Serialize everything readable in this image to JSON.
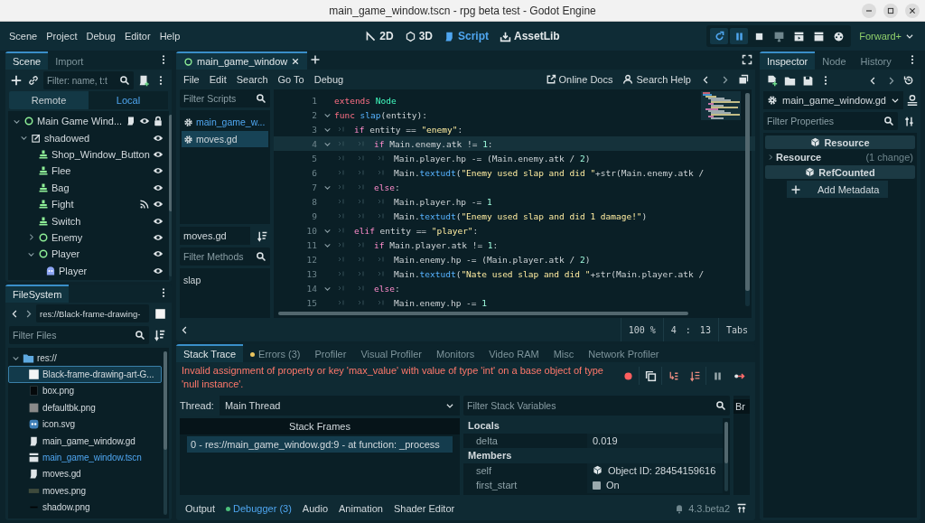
{
  "window": {
    "title": "main_game_window.tscn - rpg beta test - Godot Engine"
  },
  "menu": [
    "Scene",
    "Project",
    "Debug",
    "Editor",
    "Help"
  ],
  "workspaces": [
    {
      "label": "2D",
      "kind": "planar",
      "selected": false
    },
    {
      "label": "3D",
      "kind": "spatial",
      "selected": false
    },
    {
      "label": "Script",
      "kind": "script",
      "selected": true
    },
    {
      "label": "AssetLib",
      "kind": "assetlib",
      "selected": false
    }
  ],
  "run_controls": [
    {
      "kind": "restart",
      "on": true
    },
    {
      "kind": "pause",
      "on": true
    },
    {
      "kind": "stop",
      "on": false
    },
    {
      "kind": "remote",
      "on": false
    },
    {
      "kind": "play-scene",
      "on": false
    },
    {
      "kind": "play-custom",
      "on": false
    },
    {
      "kind": "movie",
      "on": false
    }
  ],
  "renderer": "Forward+",
  "scene_dock": {
    "tabs": [
      {
        "label": "Scene",
        "selected": true
      },
      {
        "label": "Import",
        "selected": false
      }
    ],
    "filter": {
      "placeholder": "Filter: name, t:t"
    },
    "modes": [
      {
        "label": "Remote",
        "selected": false
      },
      {
        "label": "Local",
        "selected": true
      }
    ],
    "tree": [
      {
        "label": "Main Game Wind...",
        "kind": "node",
        "expanded": true,
        "signals": false,
        "script": true,
        "visible": true,
        "locked": true,
        "children": [
          {
            "label": "shadowed",
            "kind": "layer",
            "expanded": true,
            "signals": false,
            "script": false,
            "visible": true,
            "locked": false,
            "children": [
              {
                "label": "Shop_Window_Button",
                "kind": "button",
                "signals": false,
                "script": false,
                "visible": true,
                "locked": false
              },
              {
                "label": "Flee",
                "kind": "button",
                "signals": false,
                "script": false,
                "visible": true,
                "locked": false
              },
              {
                "label": "Bag",
                "kind": "button",
                "signals": false,
                "script": false,
                "visible": true,
                "locked": false
              },
              {
                "label": "Fight",
                "kind": "button",
                "signals": true,
                "script": false,
                "visible": true,
                "locked": false
              },
              {
                "label": "Switch",
                "kind": "button",
                "signals": false,
                "script": false,
                "visible": true,
                "locked": false
              },
              {
                "label": "Enemy",
                "kind": "node",
                "expanded": false,
                "signals": false,
                "script": false,
                "visible": true,
                "locked": false
              },
              {
                "label": "Player",
                "kind": "node",
                "expanded": true,
                "signals": false,
                "script": false,
                "visible": true,
                "locked": false,
                "children": [
                  {
                    "label": "Player",
                    "kind": "sprite",
                    "signals": false,
                    "script": false,
                    "visible": true,
                    "locked": false
                  }
                ]
              }
            ]
          }
        ]
      }
    ]
  },
  "filesystem": {
    "tabs": [
      {
        "label": "FileSystem",
        "selected": true
      }
    ],
    "path": "res://Black-frame-drawing-",
    "filter": {
      "placeholder": "Filter Files"
    },
    "tree": [
      {
        "label": "res://",
        "kind": "folder",
        "expanded": true,
        "selected": false,
        "current": false,
        "children": [
          {
            "label": "Black-frame-drawing-art-G...",
            "kind": "white-image",
            "selected": true,
            "current": false
          },
          {
            "label": "box.png",
            "kind": "dark-image",
            "selected": false,
            "current": false
          },
          {
            "label": "defaultbk.png",
            "kind": "grey-image",
            "selected": false,
            "current": false
          },
          {
            "label": "icon.svg",
            "kind": "logo-image",
            "selected": false,
            "current": false
          },
          {
            "label": "main_game_window.gd",
            "kind": "script",
            "selected": false,
            "current": false
          },
          {
            "label": "main_game_window.tscn",
            "kind": "scene",
            "selected": false,
            "current": true
          },
          {
            "label": "moves.gd",
            "kind": "script",
            "selected": false,
            "current": false
          },
          {
            "label": "moves.png",
            "kind": "strip-image",
            "selected": false,
            "current": false
          },
          {
            "label": "shadow.png",
            "kind": "line-image",
            "selected": false,
            "current": false
          }
        ]
      }
    ]
  },
  "script_editor": {
    "tabs": [
      {
        "label": "main_game_window",
        "selected": true
      }
    ],
    "menu": [
      "File",
      "Edit",
      "Search",
      "Go To",
      "Debug"
    ],
    "help_links": [
      {
        "label": "Online Docs",
        "kind": "docs"
      },
      {
        "label": "Search Help",
        "kind": "help"
      }
    ],
    "script_filter": {
      "placeholder": "Filter Scripts"
    },
    "scripts": [
      {
        "label": "main_game_w...",
        "selected": false,
        "current": true
      },
      {
        "label": "moves.gd",
        "selected": true,
        "current": false
      }
    ],
    "current_script": "moves.gd",
    "method_filter": {
      "placeholder": "Filter Methods"
    },
    "methods": [
      "slap"
    ],
    "code": [
      {
        "number": "1",
        "selected": false,
        "tokens": [
          {
            "kind": "keyword",
            "text": "extends"
          },
          {
            "kind": "type",
            "text": " Node"
          }
        ]
      },
      {
        "number": "2",
        "selected": false,
        "tokens": [
          {
            "kind": "keyword",
            "text": "func"
          },
          {
            "kind": "function",
            "text": " slap"
          },
          {
            "kind": "plain",
            "text": "(entity):"
          }
        ],
        "children": [
          {
            "number": "3",
            "selected": false,
            "tokens": [
              {
                "kind": "control",
                "text": "if"
              },
              {
                "kind": "plain",
                "text": " entity == "
              },
              {
                "kind": "string",
                "text": "\"enemy\""
              },
              {
                "kind": "plain",
                "text": ":"
              }
            ],
            "children": [
              {
                "number": "4",
                "selected": true,
                "tokens": [
                  {
                    "kind": "control",
                    "text": "if"
                  },
                  {
                    "kind": "plain",
                    "text": " Main.enemy.atk != "
                  },
                  {
                    "kind": "number",
                    "text": "1"
                  },
                  {
                    "kind": "plain",
                    "text": ":"
                  }
                ],
                "children": [
                  {
                    "number": "5",
                    "selected": false,
                    "tokens": [
                      {
                        "kind": "plain",
                        "text": "Main.player.hp -= (Main.enemy.atk / "
                      },
                      {
                        "kind": "number",
                        "text": "2"
                      },
                      {
                        "kind": "plain",
                        "text": ")"
                      }
                    ]
                  },
                  {
                    "number": "6",
                    "selected": false,
                    "tokens": [
                      {
                        "kind": "plain",
                        "text": "Main."
                      },
                      {
                        "kind": "function",
                        "text": "textudt"
                      },
                      {
                        "kind": "plain",
                        "text": "("
                      },
                      {
                        "kind": "string",
                        "text": "\"Enemy used slap and did \""
                      },
                      {
                        "kind": "plain",
                        "text": "+str(Main.enemy.atk /"
                      }
                    ]
                  }
                ]
              },
              {
                "number": "7",
                "selected": false,
                "tokens": [
                  {
                    "kind": "control",
                    "text": "else"
                  },
                  {
                    "kind": "plain",
                    "text": ":"
                  }
                ],
                "children": [
                  {
                    "number": "8",
                    "selected": false,
                    "tokens": [
                      {
                        "kind": "plain",
                        "text": "Main.player.hp -= "
                      },
                      {
                        "kind": "number",
                        "text": "1"
                      }
                    ]
                  },
                  {
                    "number": "9",
                    "selected": false,
                    "tokens": [
                      {
                        "kind": "plain",
                        "text": "Main."
                      },
                      {
                        "kind": "function",
                        "text": "textudt"
                      },
                      {
                        "kind": "plain",
                        "text": "("
                      },
                      {
                        "kind": "string",
                        "text": "\"Enemy used slap and did 1 damage!\""
                      },
                      {
                        "kind": "plain",
                        "text": ")"
                      }
                    ]
                  }
                ]
              }
            ]
          },
          {
            "number": "10",
            "selected": false,
            "tokens": [
              {
                "kind": "control",
                "text": "elif"
              },
              {
                "kind": "plain",
                "text": " entity == "
              },
              {
                "kind": "string",
                "text": "\"player\""
              },
              {
                "kind": "plain",
                "text": ":"
              }
            ],
            "children": [
              {
                "number": "11",
                "selected": false,
                "tokens": [
                  {
                    "kind": "control",
                    "text": "if"
                  },
                  {
                    "kind": "plain",
                    "text": " Main.player.atk != "
                  },
                  {
                    "kind": "number",
                    "text": "1"
                  },
                  {
                    "kind": "plain",
                    "text": ":"
                  }
                ],
                "children": [
                  {
                    "number": "12",
                    "selected": false,
                    "tokens": [
                      {
                        "kind": "plain",
                        "text": "Main.enemy.hp -= (Main.player.atk / "
                      },
                      {
                        "kind": "number",
                        "text": "2"
                      },
                      {
                        "kind": "plain",
                        "text": ")"
                      }
                    ]
                  },
                  {
                    "number": "13",
                    "selected": false,
                    "tokens": [
                      {
                        "kind": "plain",
                        "text": "Main."
                      },
                      {
                        "kind": "function",
                        "text": "textudt"
                      },
                      {
                        "kind": "plain",
                        "text": "("
                      },
                      {
                        "kind": "string",
                        "text": "\"Nate used slap and did \""
                      },
                      {
                        "kind": "plain",
                        "text": "+str(Main.player.atk /"
                      }
                    ]
                  }
                ]
              },
              {
                "number": "14",
                "selected": false,
                "tokens": [
                  {
                    "kind": "control",
                    "text": "else"
                  },
                  {
                    "kind": "plain",
                    "text": ":"
                  }
                ],
                "children": [
                  {
                    "number": "15",
                    "selected": false,
                    "tokens": [
                      {
                        "kind": "plain",
                        "text": "Main.enemy.hp -= "
                      },
                      {
                        "kind": "number",
                        "text": "1"
                      }
                    ]
                  }
                ]
              }
            ]
          }
        ]
      }
    ],
    "zoom": "100 %",
    "position": {
      "line": "4",
      "separator": ":",
      "column": "13"
    },
    "indent_mode": "Tabs"
  },
  "debugger": {
    "tabs": [
      {
        "label": "Stack Trace",
        "selected": true,
        "alert": false
      },
      {
        "label": "Errors (3)",
        "selected": false,
        "alert": true
      },
      {
        "label": "Profiler",
        "selected": false,
        "alert": false
      },
      {
        "label": "Visual Profiler",
        "selected": false,
        "alert": false
      },
      {
        "label": "Monitors",
        "selected": false,
        "alert": false
      },
      {
        "label": "Video RAM",
        "selected": false,
        "alert": false
      },
      {
        "label": "Misc",
        "selected": false,
        "alert": false
      },
      {
        "label": "Network Profiler",
        "selected": false,
        "alert": false
      }
    ],
    "error": "Invalid assignment of property or key 'max_value' with value of type 'int' on a base object of type 'null instance'.",
    "thread_label": "Thread:",
    "thread": "Main Thread",
    "frames_header": "Stack Frames",
    "frames": [
      {
        "label": "0 - res://main_game_window.gd:9 - at function: _process",
        "selected": true
      }
    ],
    "variables_filter": {
      "placeholder": "Filter Stack Variables"
    },
    "variables": [
      {
        "kind": "section",
        "label": "Locals"
      },
      {
        "kind": "value",
        "name": "delta",
        "value": "0.019"
      },
      {
        "kind": "section",
        "label": "Members"
      },
      {
        "kind": "object",
        "name": "self",
        "value": "Object ID: 28454159616"
      },
      {
        "kind": "bool",
        "name": "first_start",
        "value": "On",
        "checked": true
      }
    ],
    "side_tab": "Br"
  },
  "bottom_tabs": [
    {
      "label": "Output",
      "selected": false,
      "alert": false
    },
    {
      "label": "Debugger (3)",
      "selected": true,
      "alert": true
    },
    {
      "label": "Audio",
      "selected": false,
      "alert": false
    },
    {
      "label": "Animation",
      "selected": false,
      "alert": false
    },
    {
      "label": "Shader Editor",
      "selected": false,
      "alert": false
    }
  ],
  "version": "4.3.beta2",
  "inspector": {
    "tabs": [
      {
        "label": "Inspector",
        "selected": true
      },
      {
        "label": "Node",
        "selected": false
      },
      {
        "label": "History",
        "selected": false
      }
    ],
    "resource": "main_game_window.gd",
    "filter": {
      "placeholder": "Filter Properties"
    },
    "sections": [
      {
        "kind": "category",
        "label": "Resource"
      },
      {
        "kind": "group",
        "label": "Resource",
        "note": "(1 change)",
        "expanded": false
      },
      {
        "kind": "category",
        "label": "RefCounted"
      }
    ],
    "add_metadata": "Add Metadata"
  }
}
